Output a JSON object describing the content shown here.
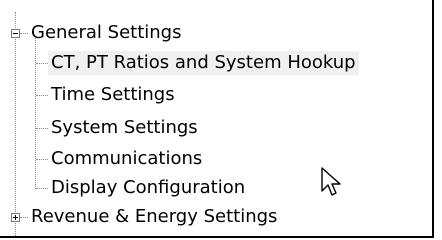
{
  "tree": {
    "groups": [
      {
        "label": "General Settings",
        "expanded": true,
        "children": [
          {
            "label": "CT, PT Ratios and System Hookup",
            "selected": true
          },
          {
            "label": "Time Settings"
          },
          {
            "label": "System Settings"
          },
          {
            "label": "Communications"
          },
          {
            "label": "Display Configuration"
          }
        ]
      },
      {
        "label": "Revenue & Energy Settings",
        "expanded": false
      }
    ]
  },
  "cursor": {
    "icon": "mouse-pointer-icon"
  }
}
